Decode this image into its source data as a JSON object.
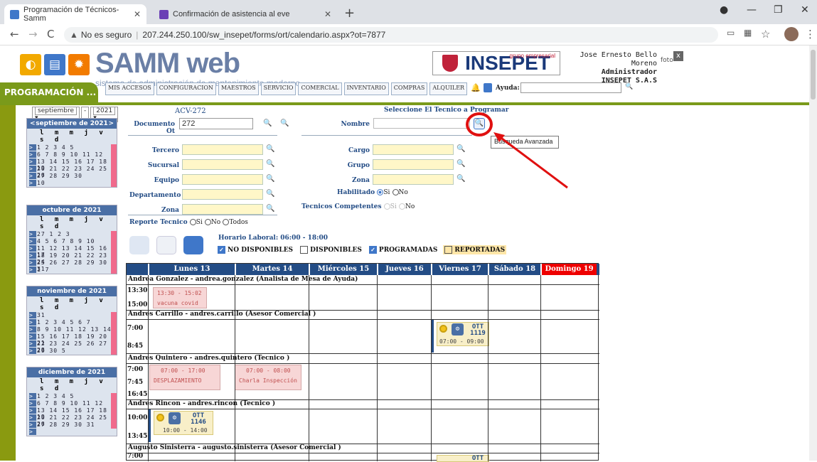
{
  "browser": {
    "tabs": [
      {
        "title": "Programación de Técnicos-Samm",
        "active": true
      },
      {
        "title": "Confirmación de asistencia al eve",
        "active": false
      }
    ],
    "security_label": "No es seguro",
    "url": "207.244.250.100/sw_insepet/forms/ort/calendario.aspx?ot=7877"
  },
  "app": {
    "brand": "SAMM web",
    "brand_sub": "sistema de administración de mantenimiento moderno",
    "section_tab": "PROGRAMACIÓN ...",
    "menu": [
      "MIS ACCESOS",
      "CONFIGURACION",
      "MAESTROS",
      "SERVICIO",
      "COMERCIAL",
      "INVENTARIO",
      "COMPRAS",
      "ALQUILER"
    ],
    "ayuda_label": "Ayuda:",
    "company_logo": "INSEPET",
    "company_logo_sub": "grupo empresarial",
    "user": {
      "name": "Jose Ernesto Bello Moreno",
      "role": "Administrador",
      "company": "INSEPET S.A.S",
      "foto": "foto"
    }
  },
  "calendar": {
    "month_select": "septiembre",
    "year_select": "2021",
    "months": [
      {
        "title": "septiembre de 2021",
        "weeks": [
          "      1  2  3  4  5",
          "6  7  8  9 10 11 12",
          "13 14 15 16 17 18 19",
          "20 21 22 23 24 25 26",
          "27 28 29 30",
          "                  10"
        ]
      },
      {
        "title": "octubre de 2021",
        "weeks": [
          "27            1  2  3",
          "4  5  6  7  8  9 10",
          "11 12 13 14 15 16 17",
          "18 19 20 21 22 23 24",
          "25 26 27 28 29 30 31",
          "1                  7"
        ]
      },
      {
        "title": "noviembre de 2021",
        "weeks": [
          "                  31",
          "1  2  3  4  5  6  7",
          "8  9 10 11 12 13 14",
          "15 16 17 18 19 20 21",
          "22 23 24 25 26 27 28",
          "29 30              5"
        ]
      },
      {
        "title": "diciembre de 2021",
        "weeks": [
          "      1  2  3  4  5",
          "6  7  8  9 10 11 12",
          "13 14 15 16 17 18 19",
          "20 21 22 23 24 25 26",
          "27 28 29 30 31",
          ""
        ]
      }
    ],
    "dow": "l m m j v s d"
  },
  "form": {
    "ot_code": "ACV-272",
    "documento_ot_label": "Documento Ot",
    "documento_ot_value": "272",
    "select_title": "Seleccione El Tecnico a Programar",
    "nombre_label": "Nombre",
    "left_fields": [
      "Tercero",
      "Sucursal",
      "Equipo",
      "Departamento",
      "Zona"
    ],
    "right_fields": [
      "Cargo",
      "Grupo",
      "Zona"
    ],
    "habilitado_label": "Habilitado",
    "competentes_label": "Tecnicos Competentes",
    "reporte_label": "Reporte Tecnico",
    "si": "Si",
    "no": "No",
    "todos": "Todos",
    "tooltip": "Búsqueda Avanzada"
  },
  "schedule": {
    "horario": "Horario Laboral: 06:00 - 18:00",
    "legend": [
      {
        "label": "NO DISPONIBLES",
        "checked": true
      },
      {
        "label": "DISPONIBLES",
        "checked": false
      },
      {
        "label": "PROGRAMADAS",
        "checked": true
      },
      {
        "label": "REPORTADAS",
        "checked": false
      }
    ],
    "days": [
      "Lunes 13",
      "Martes 14",
      "Miércoles 15",
      "Jueves 16",
      "Viernes 17",
      "Sábado 18",
      "Domingo 19"
    ],
    "people": [
      "Andrea Gonzalez - andrea.gonzalez (Analista de Mesa de Ayuda)",
      "Andres Carrillo - andres.carrillo (Asesor Comercial )",
      "Andres Quintero - andres.quintero (Tecnico )",
      "Andres Rincon - andres.rincon (Tecnico )",
      "Augusto Sinisterra - augusto.sinisterra (Asesor Comercial )"
    ],
    "times": [
      [
        "13:30",
        "15:00"
      ],
      [
        "7:00",
        "8:45"
      ],
      [
        "7:00",
        "7:45",
        "16:45"
      ],
      [
        "10:00",
        "13:45"
      ],
      [
        "7:00"
      ]
    ],
    "events": {
      "e1_time": "13:30 - 15:02",
      "e1_text": "vacuna covid",
      "e2_time": "07:00 - 17:00",
      "e2_text": "DESPLAZAMIENTO",
      "e3_time": "07:00 - 08:00",
      "e3_text": "Charla Inspección",
      "ott1_code": "OTT 1119",
      "ott1_time": "07:00 - 09:00",
      "ott2_code": "OTT 1146",
      "ott2_time": "10:00 - 14:00",
      "ott3_code": "OTT"
    }
  },
  "colors": {
    "accent": "#7a9a1a",
    "header_blue": "#234c85",
    "sunday_red": "#e00000",
    "annotation_red": "#e01010"
  }
}
